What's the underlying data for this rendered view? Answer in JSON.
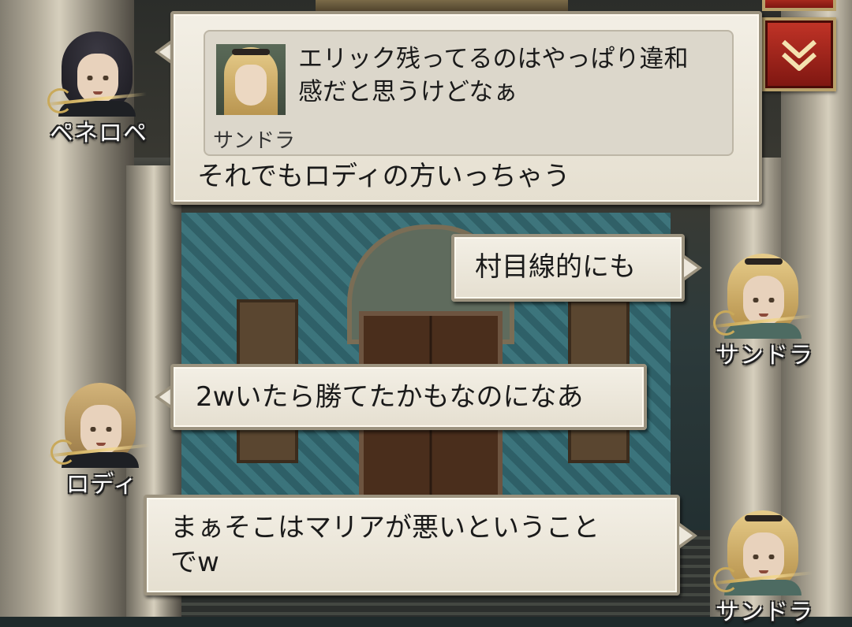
{
  "top_button": {
    "icon": "chevron-down-double-icon",
    "color": "#c23427"
  },
  "messages": [
    {
      "speaker": "ペネロペ",
      "side": "left",
      "quote": {
        "speaker": "サンドラ",
        "text": "エリック残ってるのはやっぱり違和\n感だと思うけどなぁ"
      },
      "text": "それでもロディの方いっちゃう"
    },
    {
      "speaker": "サンドラ",
      "side": "right",
      "text": "村目線的にも"
    },
    {
      "speaker": "ロディ",
      "side": "left",
      "text": "2wいたら勝てたかもなのになあ"
    },
    {
      "speaker": "サンドラ",
      "side": "right",
      "text": "まぁそこはマリアが悪いということ\nでw"
    }
  ]
}
